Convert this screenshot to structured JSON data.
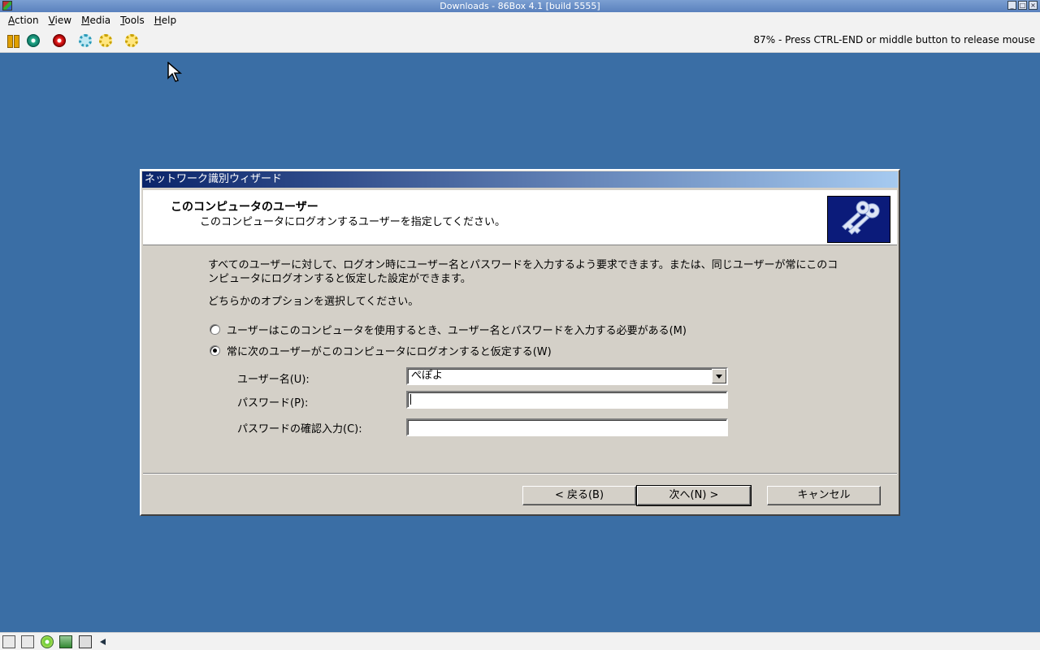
{
  "host": {
    "title": "Downloads - 86Box 4.1 [build 5555]",
    "menu": [
      "Action",
      "View",
      "Media",
      "Tools",
      "Help"
    ],
    "status_text": "87% - Press CTRL-END or middle button to release mouse",
    "toolbar_icons": [
      "pause-icon",
      "ctrl-alt-del-icon",
      "power-icon",
      "settings-icon",
      "settings-icon",
      "settings-icon"
    ],
    "statusbar_icons": [
      "floppy-icon",
      "floppy-icon",
      "cdrom-icon",
      "hdd-icon",
      "network-icon",
      "sound-icon"
    ]
  },
  "wizard": {
    "title": "ネットワーク識別ウィザード",
    "header_title": "このコンピュータのユーザー",
    "header_subtitle": "このコンピュータにログオンするユーザーを指定してください。",
    "description": "すべてのユーザーに対して、ログオン時にユーザー名とパスワードを入力するよう要求できます。または、同じユーザーが常にこのコンピュータにログオンすると仮定した設定ができます。",
    "instruction": "どちらかのオプションを選択してください。",
    "options": [
      {
        "label": "ユーザーはこのコンピュータを使用するとき、ユーザー名とパスワードを入力する必要がある(M)",
        "checked": false
      },
      {
        "label": "常に次のユーザーがこのコンピュータにログオンすると仮定する(W)",
        "checked": true
      }
    ],
    "fields": {
      "username_label": "ユーザー名(U):",
      "username_value": "ぺぽよ",
      "password_label": "パスワード(P):",
      "password_value": "",
      "confirm_label": "パスワードの確認入力(C):",
      "confirm_value": ""
    },
    "buttons": {
      "back": "< 戻る(B)",
      "next": "次へ(N) >",
      "cancel": "キャンセル"
    },
    "header_icon": "keys-icon"
  }
}
